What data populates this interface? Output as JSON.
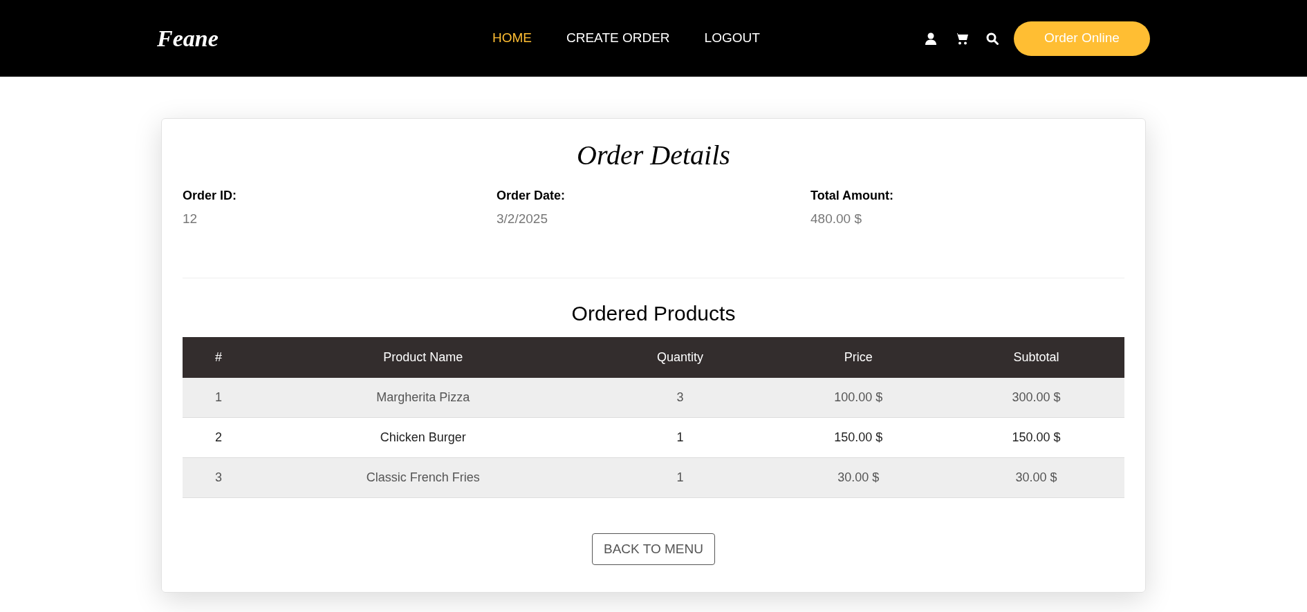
{
  "header": {
    "logo": "Feane",
    "nav": [
      {
        "label": "HOME",
        "selected": true
      },
      {
        "label": "CREATE ORDER",
        "selected": false
      },
      {
        "label": "LOGOUT",
        "selected": false
      }
    ],
    "order_button": "Order Online"
  },
  "card": {
    "title": "Order Details",
    "fields": [
      {
        "label": "Order ID:",
        "value": "12"
      },
      {
        "label": "Order Date:",
        "value": "3/2/2025"
      },
      {
        "label": "Total Amount:",
        "value": "480.00 $"
      }
    ],
    "products_title": "Ordered Products",
    "table": {
      "columns": [
        "#",
        "Product Name",
        "Quantity",
        "Price",
        "Subtotal"
      ],
      "rows": [
        [
          "1",
          "Margherita Pizza",
          "3",
          "100.00 $",
          "300.00 $"
        ],
        [
          "2",
          "Chicken Burger",
          "1",
          "150.00 $",
          "150.00 $"
        ],
        [
          "3",
          "Classic French Fries",
          "1",
          "30.00 $",
          "30.00 $"
        ]
      ]
    },
    "back_button": "BACK TO MENU"
  }
}
